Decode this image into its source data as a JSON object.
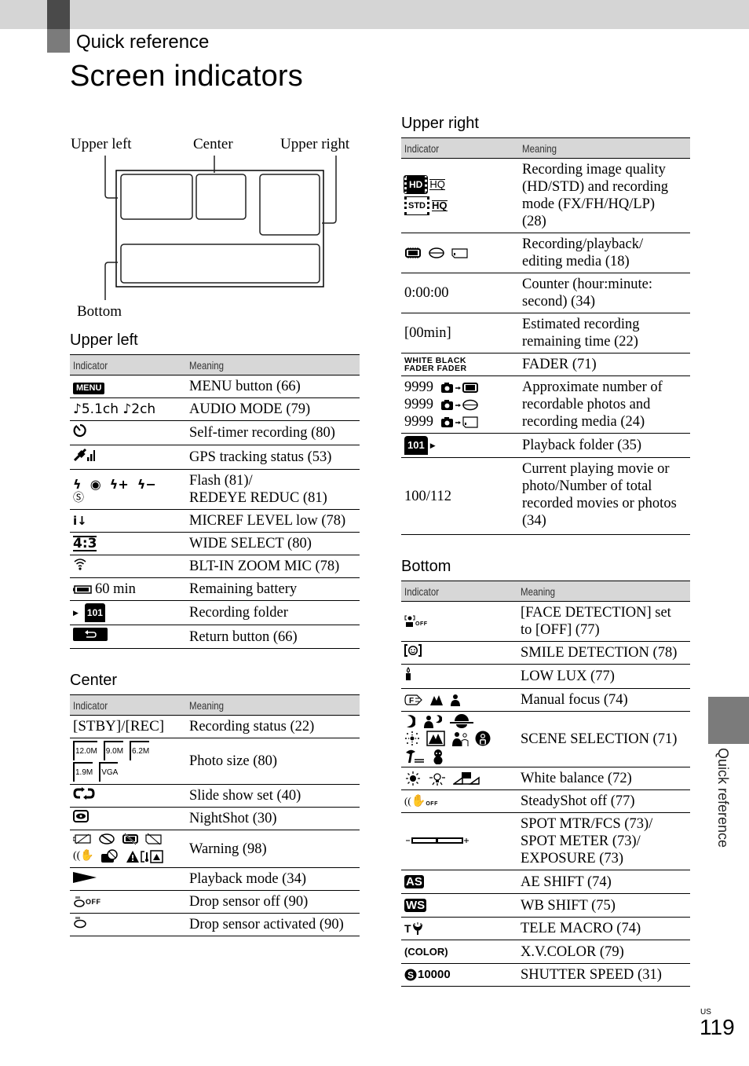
{
  "header": {
    "section": "Quick reference",
    "title": "Screen indicators"
  },
  "diagram": {
    "labels": {
      "upper_left": "Upper left",
      "center": "Center",
      "upper_right": "Upper right",
      "bottom": "Bottom"
    }
  },
  "columns": {
    "indicator": "Indicator",
    "meaning": "Meaning"
  },
  "upper_left": {
    "heading": "Upper left",
    "rows": [
      {
        "icon": "menu-button-icon",
        "indicator": "MENU",
        "meaning": "MENU button (66)"
      },
      {
        "icon": "audio-mode-icon",
        "indicator": "♪5.1ch ♪2ch",
        "meaning": "AUDIO MODE (79)"
      },
      {
        "icon": "self-timer-icon",
        "indicator": "",
        "meaning": "Self-timer recording (80)"
      },
      {
        "icon": "gps-icon",
        "indicator": "",
        "meaning": "GPS tracking status (53)"
      },
      {
        "icon": "flash-icon",
        "indicator": "",
        "meaning": "Flash (81)/\nREDEYE REDUC (81)",
        "meaning_lines": [
          "Flash (81)/",
          "REDEYE REDUC (81)"
        ]
      },
      {
        "icon": "mic-ref-low-icon",
        "indicator": "",
        "meaning": "MICREF LEVEL low (78)"
      },
      {
        "icon": "wide-select-icon",
        "indicator": "4:3",
        "meaning": "WIDE SELECT (80)"
      },
      {
        "icon": "zoom-mic-icon",
        "indicator": "",
        "meaning": "BLT-IN ZOOM MIC (78)"
      },
      {
        "icon": "battery-icon",
        "indicator": "60 min",
        "meaning": "Remaining battery"
      },
      {
        "icon": "recording-folder-icon",
        "indicator": "101",
        "meaning": "Recording folder"
      },
      {
        "icon": "return-button-icon",
        "indicator": "",
        "meaning": "Return button (66)"
      }
    ]
  },
  "center": {
    "heading": "Center",
    "rows": [
      {
        "indicator": "[STBY]/[REC]",
        "meaning": "Recording status (22)"
      },
      {
        "icon": "photo-size-icon",
        "indicator_items": [
          "12.0M",
          "9.0M",
          "6.2M",
          "1.9M",
          "VGA"
        ],
        "meaning": "Photo size (80)"
      },
      {
        "icon": "slide-show-icon",
        "indicator": "",
        "meaning": "Slide show set (40)"
      },
      {
        "icon": "nightshot-icon",
        "indicator": "",
        "meaning": "NightShot (30)"
      },
      {
        "icon": "warning-icon",
        "indicator": "",
        "meaning": "Warning (98)"
      },
      {
        "icon": "playback-icon",
        "indicator": "",
        "meaning": "Playback mode (34)"
      },
      {
        "icon": "drop-sensor-off-icon",
        "indicator": "OFF",
        "meaning": "Drop sensor off (90)"
      },
      {
        "icon": "drop-sensor-icon",
        "indicator": "",
        "meaning": "Drop sensor activated (90)"
      }
    ]
  },
  "upper_right": {
    "heading": "Upper right",
    "rows": [
      {
        "icon": "image-quality-icon",
        "indicator_items": [
          "HD",
          "HQ",
          "STD",
          "HQ"
        ],
        "meaning_lines": [
          "Recording image quality",
          "(HD/STD) and recording",
          "mode (FX/FH/HQ/LP)",
          "(28)"
        ]
      },
      {
        "icon": "media-icon",
        "indicator": "",
        "meaning_lines": [
          "Recording/playback/",
          "editing media (18)"
        ]
      },
      {
        "indicator": "0:00:00",
        "meaning_lines": [
          "Counter (hour:minute:",
          "second) (34)"
        ]
      },
      {
        "indicator": "[00min]",
        "meaning_lines": [
          "Estimated recording",
          "remaining time (22)"
        ]
      },
      {
        "icon": "fader-icon",
        "indicator_lines": [
          "WHITE BLACK",
          "FADER FADER"
        ],
        "meaning_lines": [
          "FADER (71)"
        ]
      },
      {
        "icon": "photo-count-icon",
        "indicator_items": [
          "9999",
          "9999",
          "9999"
        ],
        "meaning_lines": [
          "Approximate number of",
          "recordable photos and",
          "recording media (24)"
        ]
      },
      {
        "icon": "playback-folder-icon",
        "indicator": "101",
        "meaning_lines": [
          "Playback folder (35)"
        ]
      },
      {
        "indicator": "100/112",
        "meaning_lines": [
          "Current playing movie or",
          "photo/Number of total",
          "recorded movies or photos",
          "(34)"
        ]
      }
    ]
  },
  "bottom": {
    "heading": "Bottom",
    "rows": [
      {
        "icon": "face-detection-off-icon",
        "indicator": "OFF",
        "meaning_lines": [
          "[FACE DETECTION] set",
          "to [OFF] (77)"
        ]
      },
      {
        "icon": "smile-detection-icon",
        "meaning_lines": [
          "SMILE DETECTION (78)"
        ]
      },
      {
        "icon": "low-lux-icon",
        "meaning_lines": [
          "LOW LUX (77)"
        ]
      },
      {
        "icon": "manual-focus-icon",
        "indicator": "F",
        "meaning_lines": [
          "Manual focus (74)"
        ]
      },
      {
        "icon": "scene-selection-icon",
        "meaning_lines": [
          "SCENE SELECTION (71)"
        ]
      },
      {
        "icon": "white-balance-icon",
        "meaning_lines": [
          "White balance (72)"
        ]
      },
      {
        "icon": "steadyshot-off-icon",
        "indicator": "OFF",
        "meaning_lines": [
          "SteadyShot off (77)"
        ]
      },
      {
        "icon": "exposure-bar-icon",
        "meaning_lines": [
          "SPOT MTR/FCS (73)/",
          "SPOT METER (73)/",
          "EXPOSURE (73)"
        ]
      },
      {
        "icon": "ae-shift-icon",
        "indicator": "AS",
        "meaning_lines": [
          "AE SHIFT (74)"
        ]
      },
      {
        "icon": "wb-shift-icon",
        "indicator": "WS",
        "meaning_lines": [
          "WB SHIFT (75)"
        ]
      },
      {
        "icon": "tele-macro-icon",
        "indicator": "T",
        "meaning_lines": [
          "TELE MACRO (74)"
        ]
      },
      {
        "icon": "xv-color-icon",
        "indicator": "(COLOR)",
        "meaning_lines": [
          "X.V.COLOR (79)"
        ]
      },
      {
        "icon": "shutter-speed-icon",
        "indicator": "10000",
        "meaning_lines": [
          "SHUTTER SPEED (31)"
        ]
      }
    ]
  },
  "side_tab": {
    "label": "Quick reference"
  },
  "footer": {
    "region": "US",
    "page_number": "119"
  }
}
